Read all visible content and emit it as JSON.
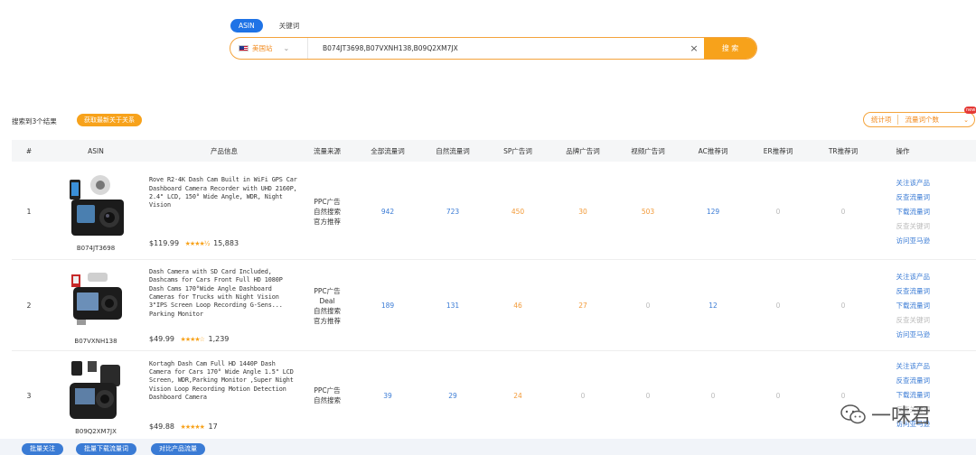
{
  "search": {
    "tabs": [
      {
        "label": "ASIN",
        "active": true
      },
      {
        "label": "关键词",
        "active": false
      }
    ],
    "site_label": "美国站",
    "query": "B074JT3698,B07VXNH138,B09Q2XM7JX",
    "button_label": "搜 索"
  },
  "summary": {
    "result_text": "搜索到3个结果",
    "action_pill": "获取最新关于关系"
  },
  "filter": {
    "label": "统计项",
    "value": "流量词个数",
    "badge": "new"
  },
  "table": {
    "columns": [
      "#",
      "ASIN",
      "产品信息",
      "流量来源",
      "全部流量词",
      "自然流量词",
      "SP广告词",
      "品牌广告词",
      "视频广告词",
      "AC推荐词",
      "ER推荐词",
      "TR推荐词",
      "操作"
    ],
    "rows": [
      {
        "no": "1",
        "asin": "B074JT3698",
        "title": "Rove R2-4K Dash Cam Built in WiFi GPS Car Dashboard Camera Recorder with UHD 2160P, 2.4\" LCD, 150° Wide Angle, WDR, Night Vision",
        "price": "$119.99",
        "stars": "★★★★½",
        "reviews": "15,883",
        "sources": [
          "PPC广告",
          "自然搜索",
          "官方推荐"
        ],
        "all": "942",
        "natural": "723",
        "sp": "450",
        "brand": "30",
        "video": "503",
        "ac": "129",
        "er": "0",
        "tr": "0"
      },
      {
        "no": "2",
        "asin": "B07VXNH138",
        "title": "Dash Camera with SD Card Included, Dashcams for Cars Front Full HD 1080P Dash Cams 170°Wide Angle Dashboard Cameras for Trucks with Night Vision 3\"IPS Screen Loop Recording G-Sens... Parking Monitor",
        "price": "$49.99",
        "stars": "★★★★☆",
        "reviews": "1,239",
        "sources": [
          "PPC广告",
          "Deal",
          "自然搜索",
          "官方推荐"
        ],
        "all": "189",
        "natural": "131",
        "sp": "46",
        "brand": "27",
        "video": "0",
        "ac": "12",
        "er": "0",
        "tr": "0"
      },
      {
        "no": "3",
        "asin": "B09Q2XM7JX",
        "title": "Kortagh Dash Cam Full HD 1440P Dash Camera for Cars 170° Wide Angle 1.5\" LCD Screen, WDR,Parking Monitor ,Super Night Vision Loop Recording Motion Detection Dashboard Camera",
        "price": "$49.88",
        "stars": "★★★★★",
        "reviews": "17",
        "sources": [
          "PPC广告",
          "自然搜索"
        ],
        "all": "39",
        "natural": "29",
        "sp": "24",
        "brand": "0",
        "video": "0",
        "ac": "0",
        "er": "0",
        "tr": "0"
      }
    ],
    "ops": [
      "关注该产品",
      "反查流量词",
      "下载流量词",
      "反查关键词",
      "访问亚马逊"
    ]
  },
  "bottom": {
    "buttons": [
      "批量关注",
      "批量下载流量词",
      "对比产品流量"
    ]
  },
  "watermark": "一味君",
  "colors": {
    "primary": "#1f73e6",
    "accent": "#f7a21b",
    "link": "#3a7bd5"
  }
}
